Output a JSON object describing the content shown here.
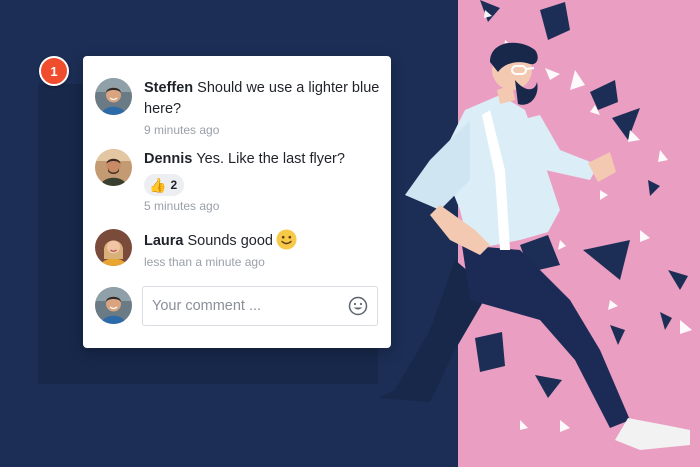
{
  "pin": {
    "label": "1",
    "color": "#ef4d2e"
  },
  "comments": [
    {
      "author": "Steffen",
      "text": "Should we use a lighter blue here?",
      "time": "9 minutes ago",
      "avatar": "avatar-steffen"
    },
    {
      "author": "Dennis",
      "text": "Yes. Like the last flyer?",
      "time": "5 minutes ago",
      "avatar": "avatar-dennis",
      "reaction": {
        "emoji": "👍",
        "count": "2"
      }
    },
    {
      "author": "Laura",
      "text": "Sounds good",
      "time": "less than a minute ago",
      "avatar": "avatar-laura",
      "emoji": "smiley-icon"
    }
  ],
  "composer": {
    "placeholder": "Your comment ...",
    "emoji_button": "smiley-outline-icon"
  },
  "colors": {
    "navy": "#1c2e55",
    "pink": "#ea9ec2",
    "accent": "#ef4d2e"
  }
}
